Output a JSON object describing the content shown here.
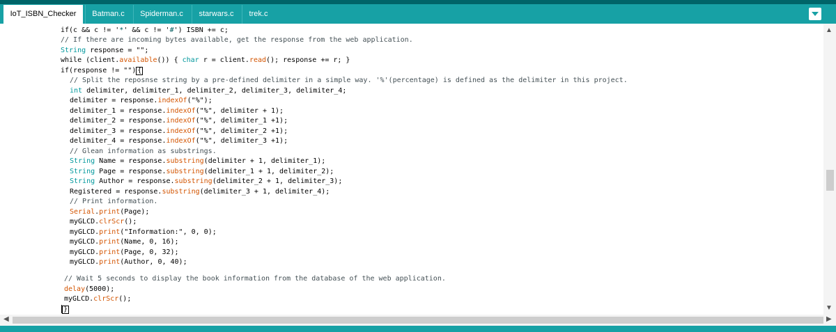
{
  "tabs": [
    {
      "label": "IoT_ISBN_Checker",
      "active": true
    },
    {
      "label": "Batman.c",
      "active": false
    },
    {
      "label": "Spiderman.c",
      "active": false
    },
    {
      "label": "starwars.c",
      "active": false
    },
    {
      "label": "trek.c",
      "active": false
    }
  ],
  "icons": {
    "tab_menu": "chevron-down-icon",
    "scroll_up": "arrow-up-icon",
    "scroll_down": "arrow-down-icon",
    "scroll_left": "arrow-left-icon",
    "scroll_right": "arrow-right-icon"
  },
  "colors": {
    "tab_bar": "#17a1a5",
    "top_strip": "#006468",
    "keyword": "#00979c",
    "function": "#d35400",
    "comment": "#434f54"
  },
  "code": {
    "l1_a": "if(c && c != '",
    "l1_b": "*",
    "l1_c": "' && c != '",
    "l1_d": "#",
    "l1_e": "') ISBN += c;",
    "l2": "// If there are incoming bytes available, get the response from the web application.",
    "l3_a": "String",
    "l3_b": " response = \"\";",
    "l4_a": "while (client.",
    "l4_b": "available",
    "l4_c": "()) { ",
    "l4_d": "char",
    "l4_e": " r = client.",
    "l4_f": "read",
    "l4_g": "(); response += r; }",
    "l5_a": "if(response != \"\")",
    "l5_b": "{",
    "l6": "// Split the reposnse string by a pre-defined delimiter in a simple way. '%'(percentage) is defined as the delimiter in this project.",
    "l7_a": "int",
    "l7_b": " delimiter, delimiter_1, delimiter_2, delimiter_3, delimiter_4;",
    "l8_a": "delimiter = response.",
    "l8_b": "indexOf",
    "l8_c": "(\"%\");",
    "l9_a": "delimiter_1 = response.",
    "l9_b": "indexOf",
    "l9_c": "(\"%\", delimiter + 1);",
    "l10_a": "delimiter_2 = response.",
    "l10_b": "indexOf",
    "l10_c": "(\"%\", delimiter_1 +1);",
    "l11_a": "delimiter_3 = response.",
    "l11_b": "indexOf",
    "l11_c": "(\"%\", delimiter_2 +1);",
    "l12_a": "delimiter_4 = response.",
    "l12_b": "indexOf",
    "l12_c": "(\"%\", delimiter_3 +1);",
    "l13": "// Glean information as substrings.",
    "l14_a": "String",
    "l14_b": " Name = response.",
    "l14_c": "substring",
    "l14_d": "(delimiter + 1, delimiter_1);",
    "l15_a": "String",
    "l15_b": " Page = response.",
    "l15_c": "substring",
    "l15_d": "(delimiter_1 + 1, delimiter_2);",
    "l16_a": "String",
    "l16_b": " Author = response.",
    "l16_c": "substring",
    "l16_d": "(delimiter_2 + 1, delimiter_3);",
    "l17_a": "Registered = response.",
    "l17_b": "substring",
    "l17_c": "(delimiter_3 + 1, delimiter_4);",
    "l18": "// Print information.",
    "l19_a": "Serial",
    "l19_b": ".",
    "l19_c": "print",
    "l19_d": "(Page);",
    "l20_a": "myGLCD.",
    "l20_b": "clrScr",
    "l20_c": "();",
    "l21_a": "myGLCD.",
    "l21_b": "print",
    "l21_c": "(\"Information:\", 0, 0);",
    "l22_a": "myGLCD.",
    "l22_b": "print",
    "l22_c": "(Name, 0, 16);",
    "l23_a": "myGLCD.",
    "l23_b": "print",
    "l23_c": "(Page, 0, 32);",
    "l24_a": "myGLCD.",
    "l24_b": "print",
    "l24_c": "(Author, 0, 40);",
    "l25": "// Wait 5 seconds to display the book information from the database of the web application.",
    "l26_a": "delay",
    "l26_b": "(5000);",
    "l27_a": "myGLCD.",
    "l27_b": "clrScr",
    "l27_c": "();",
    "l28": "}"
  }
}
